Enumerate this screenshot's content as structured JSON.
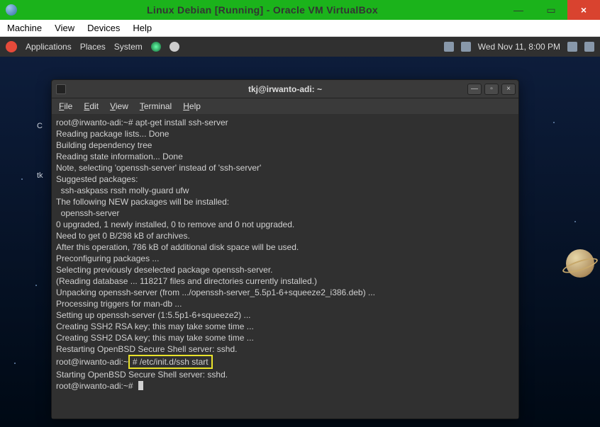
{
  "host_window": {
    "title": "Linux Debian [Running] - Oracle VM VirtualBox",
    "menu": {
      "machine": "Machine",
      "view": "View",
      "devices": "Devices",
      "help": "Help"
    },
    "buttons": {
      "minimize": "—",
      "maximize": "▭",
      "close": "×"
    }
  },
  "gnome_panel": {
    "applications": "Applications",
    "places": "Places",
    "system": "System",
    "clock": "Wed Nov 11,  8:00 PM"
  },
  "desktop": {
    "label1": "C",
    "label2": "tk"
  },
  "terminal": {
    "title": "tkj@irwanto-adi: ~",
    "menu": {
      "file": "File",
      "edit": "Edit",
      "view": "View",
      "terminal": "Terminal",
      "help": "Help"
    },
    "buttons": {
      "minimize": "—",
      "maximize": "▫",
      "close": "×"
    },
    "lines": [
      "root@irwanto-adi:~# apt-get install ssh-server",
      "Reading package lists... Done",
      "Building dependency tree",
      "Reading state information... Done",
      "Note, selecting 'openssh-server' instead of 'ssh-server'",
      "Suggested packages:",
      "  ssh-askpass rssh molly-guard ufw",
      "The following NEW packages will be installed:",
      "  openssh-server",
      "0 upgraded, 1 newly installed, 0 to remove and 0 not upgraded.",
      "Need to get 0 B/298 kB of archives.",
      "After this operation, 786 kB of additional disk space will be used.",
      "Preconfiguring packages ...",
      "Selecting previously deselected package openssh-server.",
      "(Reading database ... 118217 files and directories currently installed.)",
      "Unpacking openssh-server (from .../openssh-server_5.5p1-6+squeeze2_i386.deb) ...",
      "Processing triggers for man-db ...",
      "Setting up openssh-server (1:5.5p1-6+squeeze2) ...",
      "Creating SSH2 RSA key; this may take some time ...",
      "Creating SSH2 DSA key; this may take some time ...",
      "Restarting OpenBSD Secure Shell server: sshd."
    ],
    "highlight_prefix": "root@irwanto-adi:~",
    "highlight_cmd": "# /etc/init.d/ssh start",
    "after_lines": [
      "Starting OpenBSD Secure Shell server: sshd.",
      "root@irwanto-adi:~#"
    ]
  }
}
